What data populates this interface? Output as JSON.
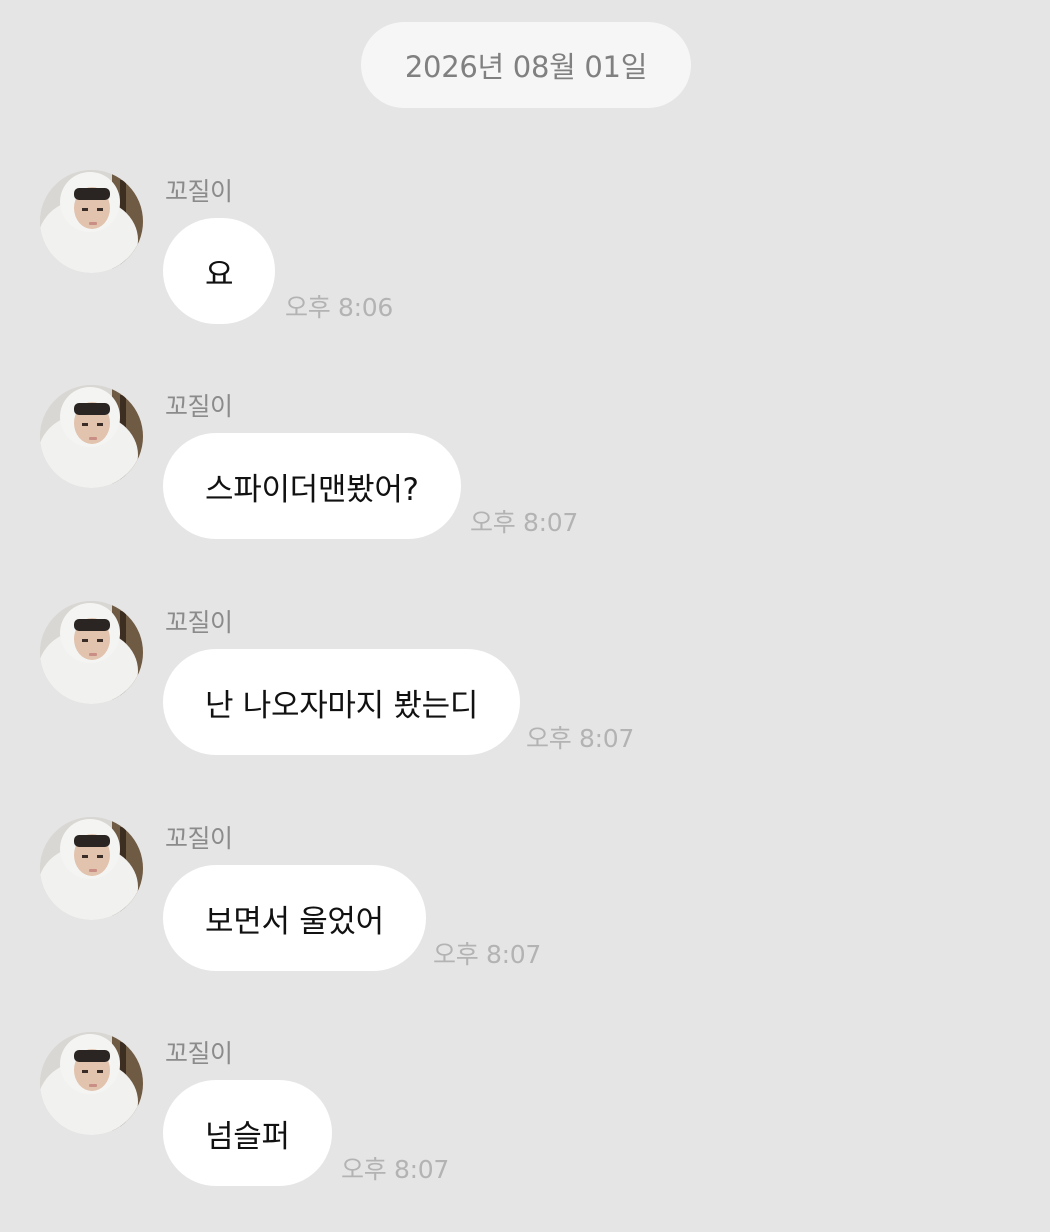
{
  "date_divider": "2026년 08월 01일",
  "messages": [
    {
      "sender": "꼬질이",
      "text": "요",
      "time": "오후 8:06"
    },
    {
      "sender": "꼬질이",
      "text": "스파이더맨봤어?",
      "time": "오후 8:07"
    },
    {
      "sender": "꼬질이",
      "text": "난 나오자마지 봤는디",
      "time": "오후 8:07"
    },
    {
      "sender": "꼬질이",
      "text": "보면서 울었어",
      "time": "오후 8:07"
    },
    {
      "sender": "꼬질이",
      "text": "넘슬퍼",
      "time": "오후 8:07"
    }
  ],
  "colors": {
    "background": "#e5e5e5",
    "bubble": "#ffffff",
    "date_pill": "#f6f6f6",
    "sender_text": "#8b8b8b",
    "time_text": "#b3b3b3"
  },
  "icons": {
    "avatar": "profile-photo-avatar"
  }
}
